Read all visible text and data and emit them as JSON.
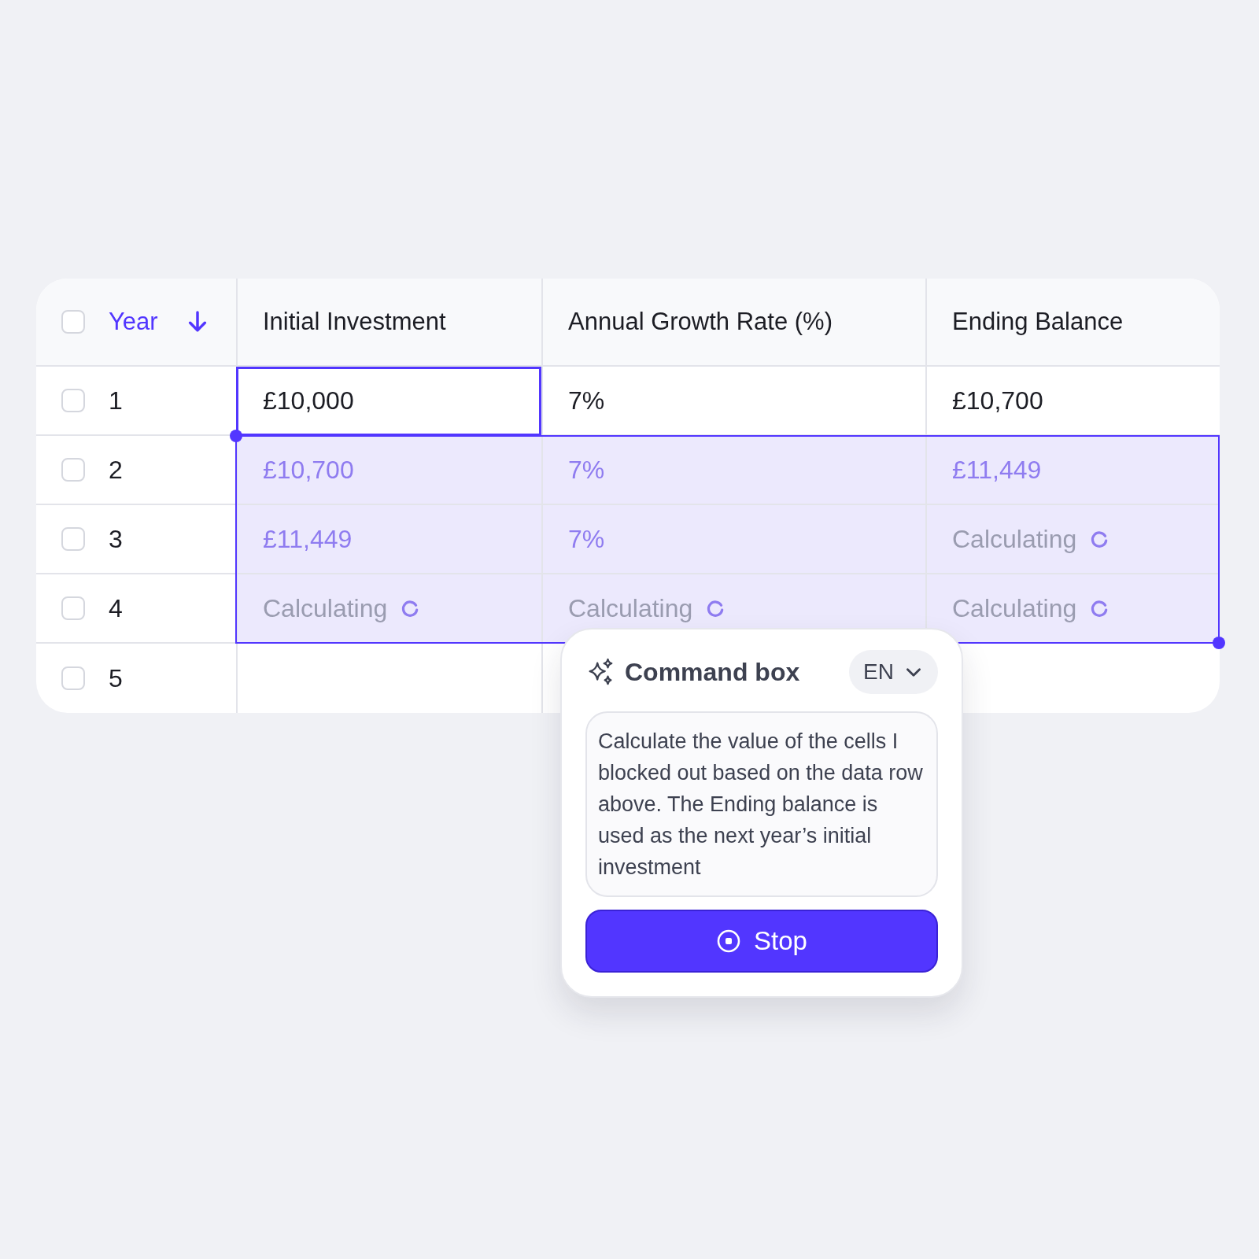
{
  "table": {
    "select_all": {
      "checked": false
    },
    "columns": [
      {
        "label": "Year",
        "sorted": true
      },
      {
        "label": "Initial Investment",
        "sorted": false
      },
      {
        "label": "Annual Growth Rate (%)",
        "sorted": false
      },
      {
        "label": "Ending Balance",
        "sorted": false
      }
    ],
    "rows": [
      {
        "checked": false,
        "year": "1",
        "cells": [
          {
            "kind": "value",
            "text": "£10,000",
            "selected": false,
            "active": true
          },
          {
            "kind": "value",
            "text": "7%",
            "selected": false,
            "active": false
          },
          {
            "kind": "value",
            "text": "£10,700",
            "selected": false,
            "active": false
          }
        ]
      },
      {
        "checked": false,
        "year": "2",
        "cells": [
          {
            "kind": "value",
            "text": "£10,700",
            "selected": true,
            "active": false
          },
          {
            "kind": "value",
            "text": "7%",
            "selected": true,
            "active": false
          },
          {
            "kind": "value",
            "text": "£11,449",
            "selected": true,
            "active": false
          }
        ]
      },
      {
        "checked": false,
        "year": "3",
        "cells": [
          {
            "kind": "value",
            "text": "£11,449",
            "selected": true,
            "active": false
          },
          {
            "kind": "value",
            "text": "7%",
            "selected": true,
            "active": false
          },
          {
            "kind": "calculating",
            "text": "Calculating",
            "selected": true,
            "active": false
          }
        ]
      },
      {
        "checked": false,
        "year": "4",
        "cells": [
          {
            "kind": "calculating",
            "text": "Calculating",
            "selected": true,
            "active": false
          },
          {
            "kind": "calculating",
            "text": "Calculating",
            "selected": true,
            "active": false
          },
          {
            "kind": "calculating",
            "text": "Calculating",
            "selected": true,
            "active": false
          }
        ]
      },
      {
        "checked": false,
        "year": "5"
      }
    ]
  },
  "command_box": {
    "title": "Command box",
    "language": "EN",
    "prompt": {
      "value": "Calculate the value of the cells I blocked out based on the data row above. The Ending balance is used as the next year’s initial investment"
    },
    "button": {
      "label": "Stop",
      "kind": "stop"
    }
  }
}
